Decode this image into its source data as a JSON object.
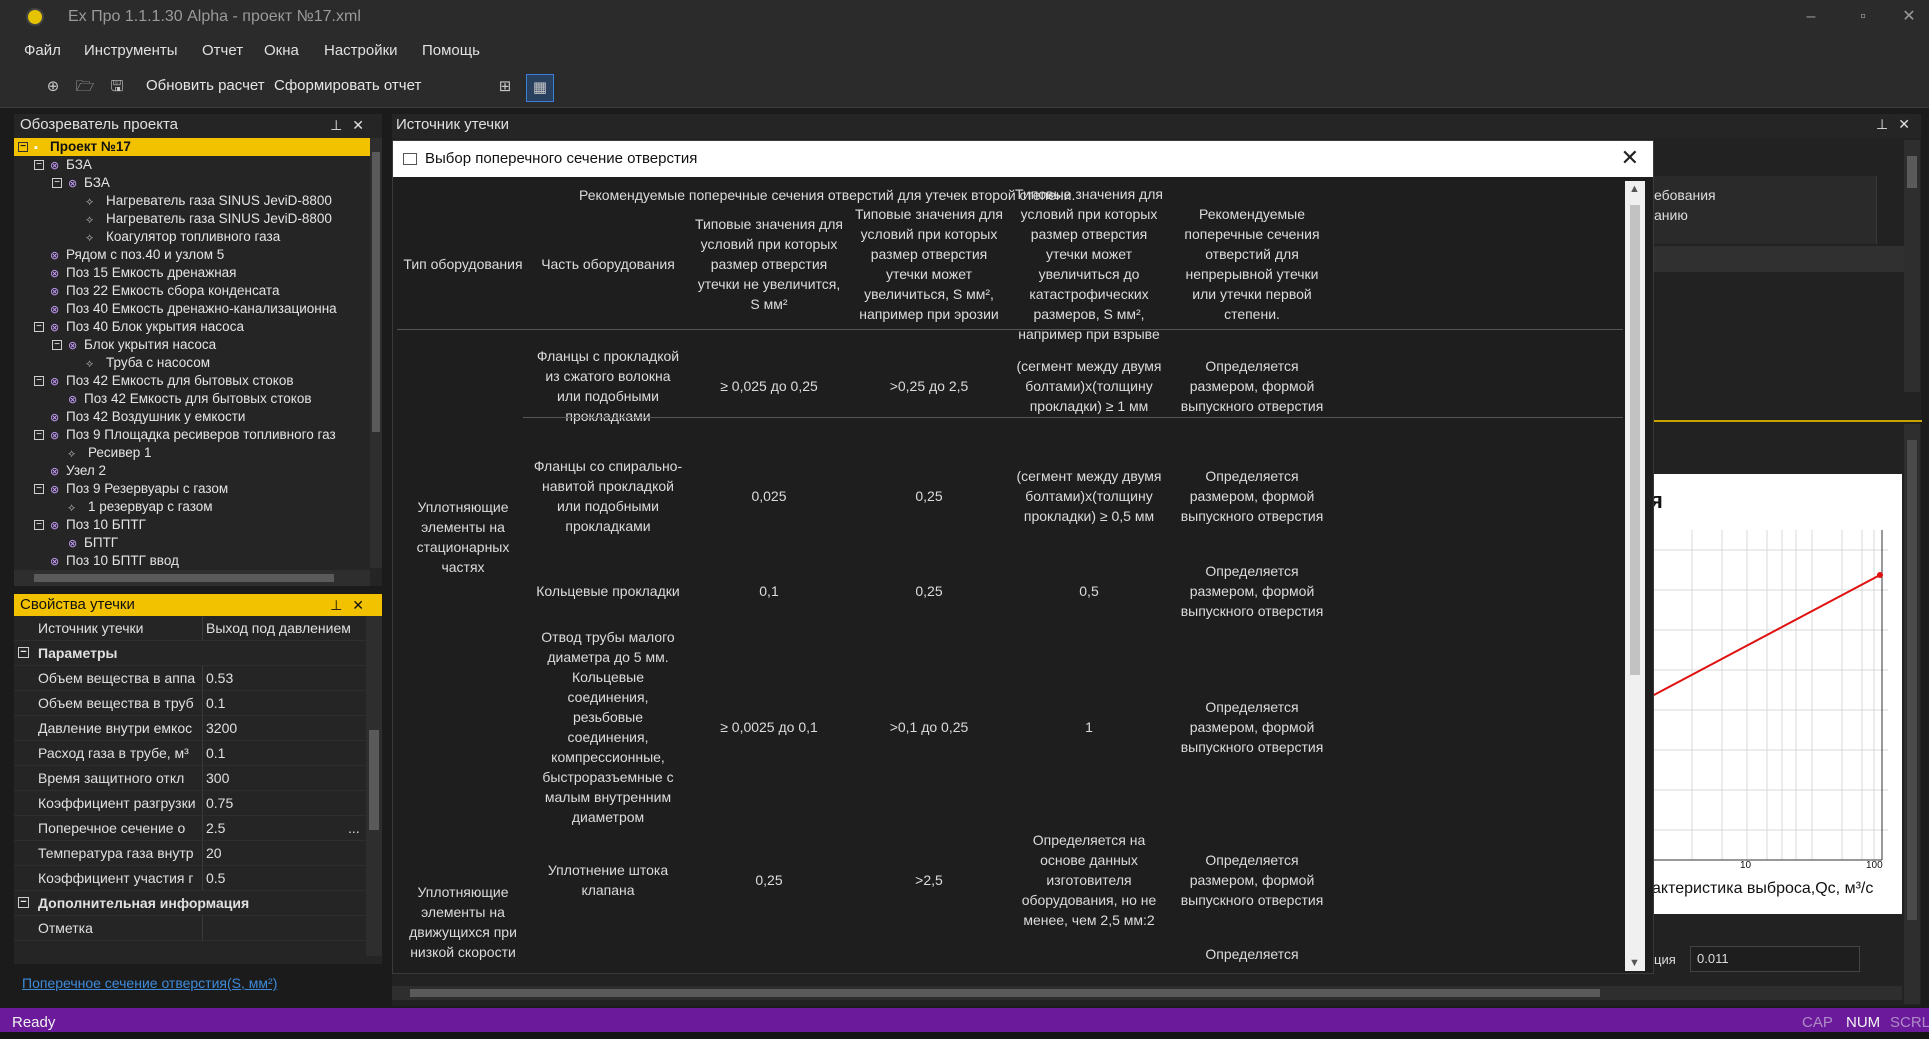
{
  "window": {
    "title": "Ex Про 1.1.1.30 Alpha - проект №17.xml",
    "minimize": "–",
    "maximize": "▫",
    "close": "✕"
  },
  "menu": [
    "Файл",
    "Инструменты",
    "Отчет",
    "Окна",
    "Настройки",
    "Помощь"
  ],
  "toolbar": {
    "update_label": "Обновить расчет",
    "report_label": "Сформировать отчет"
  },
  "explorer": {
    "title": "Обозреватель проекта",
    "root": "Проект №17",
    "items": [
      {
        "label": "БЗА",
        "level": 1,
        "kind": "node",
        "exp": "−"
      },
      {
        "label": "БЗА",
        "level": 2,
        "kind": "node",
        "exp": "−"
      },
      {
        "label": "Нагреватель газа SINUS JeviD-8800",
        "level": 3,
        "kind": "leaf"
      },
      {
        "label": "Нагреватель газа SINUS JeviD-8800",
        "level": 3,
        "kind": "leaf"
      },
      {
        "label": "Коагулятор топливного газа",
        "level": 3,
        "kind": "leaf"
      },
      {
        "label": "Рядом с поз.40 и узлом 5",
        "level": 1,
        "kind": "node"
      },
      {
        "label": "Поз 15 Емкость дренажная",
        "level": 1,
        "kind": "node"
      },
      {
        "label": "Поз 22 Емкость сбора конденсата",
        "level": 1,
        "kind": "node"
      },
      {
        "label": "Поз 40 Емкость дренажно-канализационна",
        "level": 1,
        "kind": "node"
      },
      {
        "label": "Поз 40 Блок укрытия насоса",
        "level": 1,
        "kind": "node",
        "exp": "−"
      },
      {
        "label": "Блок укрытия насоса",
        "level": 2,
        "kind": "node",
        "exp": "−"
      },
      {
        "label": "Труба с насосом",
        "level": 3,
        "kind": "leaf"
      },
      {
        "label": "Поз 42 Емкость для бытовых стоков",
        "level": 1,
        "kind": "node",
        "exp": "−"
      },
      {
        "label": "Поз 42 Емкость для бытовых стоков",
        "level": 2,
        "kind": "node"
      },
      {
        "label": "Поз 42 Воздушник у емкости",
        "level": 1,
        "kind": "node"
      },
      {
        "label": "Поз 9 Площадка ресиверов топливного газ",
        "level": 1,
        "kind": "node",
        "exp": "−"
      },
      {
        "label": "Ресивер 1",
        "level": 2,
        "kind": "leaf"
      },
      {
        "label": "Узел 2",
        "level": 1,
        "kind": "node"
      },
      {
        "label": "Поз 9 Резервуары с газом",
        "level": 1,
        "kind": "node",
        "exp": "−"
      },
      {
        "label": "1 резервуар с газом",
        "level": 2,
        "kind": "leaf"
      },
      {
        "label": "Поз 10 БПТГ",
        "level": 1,
        "kind": "node",
        "exp": "−"
      },
      {
        "label": "БПТГ",
        "level": 2,
        "kind": "node"
      },
      {
        "label": "Поз 10 БПТГ ввод",
        "level": 1,
        "kind": "node"
      }
    ]
  },
  "props": {
    "title": "Свойства утечки",
    "top_row": {
      "name": "Источник утечки",
      "value": "Выход под давлением"
    },
    "cat1": "Параметры",
    "rows": [
      {
        "name": "Объем вещества в аппа",
        "value": "0.53"
      },
      {
        "name": "Объем вещества в труб",
        "value": "0.1"
      },
      {
        "name": "Давление внутри емкос",
        "value": "3200"
      },
      {
        "name": "Расход газа в трубе, м³",
        "value": "0.1"
      },
      {
        "name": "Время защитного откл",
        "value": "300"
      },
      {
        "name": "Коэффициент разгрузки",
        "value": "0.75"
      },
      {
        "name": "Поперечное сечение о",
        "value": "2.5",
        "extra": "..."
      },
      {
        "name": "Температура газа внутр",
        "value": "20"
      },
      {
        "name": "Коэффициент участия г",
        "value": "0.5"
      }
    ],
    "cat2": "Дополнительная информация",
    "note_row": {
      "name": "Отметка",
      "value": ""
    },
    "hint": "Поперечное сечение отверстия(S, мм²)"
  },
  "doc": {
    "title": "Источник утечки",
    "bg_header_line1": "ебования",
    "bg_header_line2": "анию",
    "bg_chart_title": "я",
    "bg_tick_10": "10",
    "bg_tick_100": "100",
    "bg_xlabel": "актеристика выброса,Qc, м³/с",
    "bg_field_label": "ция",
    "bg_field_value": "0.011"
  },
  "dialog": {
    "title": "Выбор поперечного сечение отверстия",
    "caption": "Рекомендуемые поперечные сечения отверстий для утечек второй степени.",
    "headers": [
      "Тип оборудования",
      "Часть оборудования",
      "Типовые значения для условий при которых размер отверстия утечки не увеличится, S мм²",
      "Типовые значения для условий при которых размер отверстия утечки может увеличиться, S мм², например при эрозии",
      "Типовые значения для условий при которых размер отверстия утечки может увеличиться до катастрофических размеров, S мм², например  при взрыве",
      "Рекомендуемые поперечные сечения отверстий для непрерывной утечки или утечки первой степени."
    ],
    "group1": "Уплотняющие элементы на стационарных частях",
    "group2": "Уплотняющие элементы на движущихся при низкой скорости",
    "rows": [
      {
        "part": "Фланцы с прокладкой из сжатого волокна или подобными прокладками",
        "c1": "≥ 0,025 до 0,25",
        "c2": ">0,25 до 2,5",
        "c3": "(сегмент между двумя болтами)х(толщину прокладки) ≥  1 мм",
        "c4": "Определяется размером, формой выпускного отверстия"
      },
      {
        "part": "Фланцы со спирально-навитой прокладкой или подобными прокладками",
        "c1": "0,025",
        "c2": "0,25",
        "c3": "(сегмент между двумя болтами)х(толщину прокладки) ≥  0,5 мм",
        "c4": "Определяется размером, формой выпускного отверстия"
      },
      {
        "part": "Кольцевые прокладки",
        "c1": "0,1",
        "c2": "0,25",
        "c3": "0,5",
        "c4": "Определяется размером, формой выпускного отверстия"
      },
      {
        "part": "Отвод трубы малого диаметра до 5 мм. Кольцевые соединения, резьбовые соединения, компрессионные, быстроразъемные с малым внутренним диаметром",
        "c1": "≥ 0,0025 до 0,1",
        "c2": ">0,1 до 0,25",
        "c3": "1",
        "c4": "Определяется размером, формой выпускного отверстия"
      },
      {
        "part": "Уплотнение штока клапана",
        "c1": "0,25",
        "c2": ">2,5",
        "c3": "Определяется на основе данных изготовителя оборудования, но не менее, чем 2,5 мм:2",
        "c4": "Определяется размером, формой выпускного отверстия"
      },
      {
        "part": "",
        "c1": "",
        "c2": "",
        "c3": "",
        "c4": "Определяется"
      }
    ]
  },
  "status": {
    "text": "Ready",
    "cap": "CAP",
    "num": "NUM",
    "scrl": "SCRL"
  }
}
